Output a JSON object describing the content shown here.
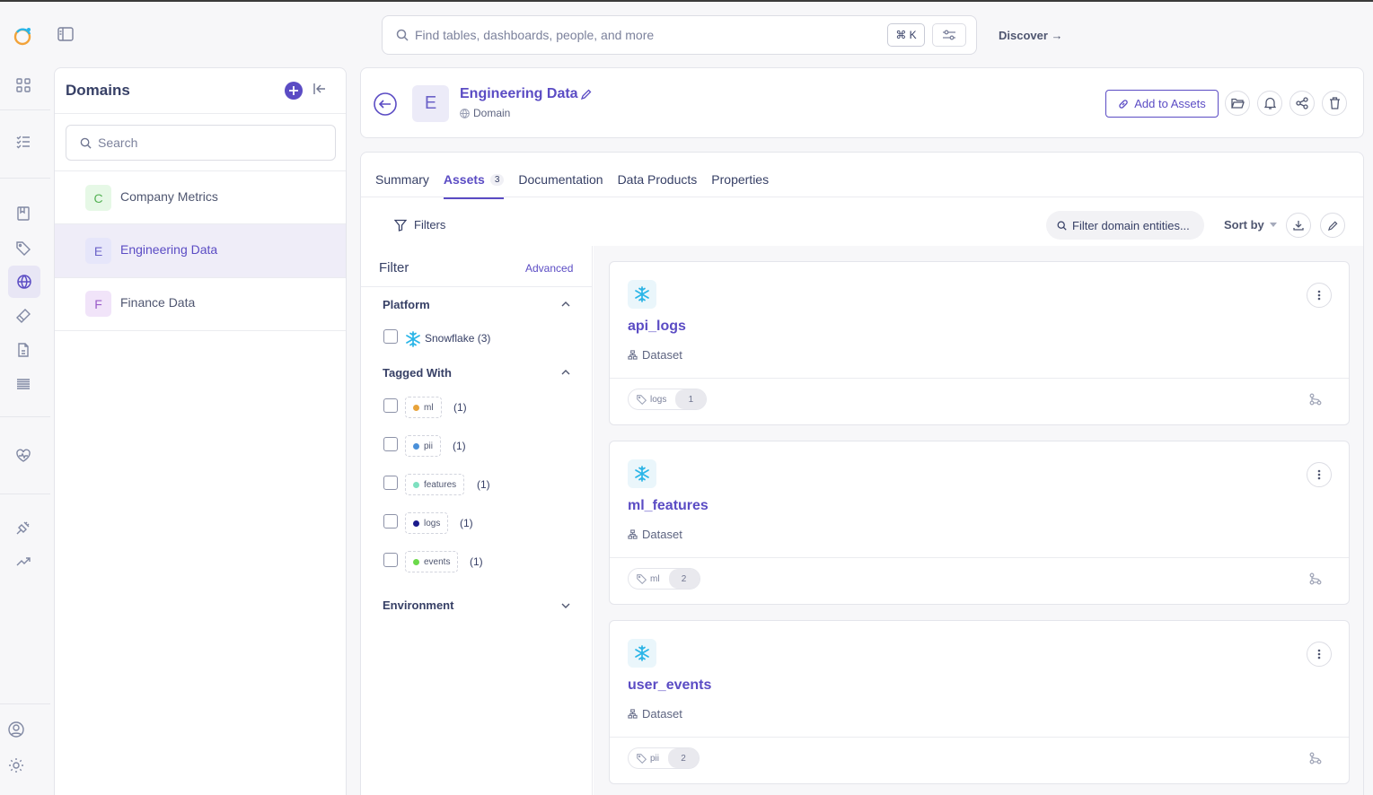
{
  "search": {
    "placeholder": "Find tables, dashboards, people, and more",
    "shortcut": "⌘ K"
  },
  "top": {
    "discover_label": "Discover →"
  },
  "domains": {
    "title": "Domains",
    "search_placeholder": "Search",
    "items": [
      {
        "letter": "C",
        "name": "Company Metrics",
        "color": "#dff7df",
        "text_color": "#55b255"
      },
      {
        "letter": "E",
        "name": "Engineering Data",
        "color": "#e6e6fa",
        "text_color": "#6c63c8"
      },
      {
        "letter": "F",
        "name": "Finance Data",
        "color": "#f1e4f9",
        "text_color": "#9b5cc8"
      }
    ]
  },
  "entity": {
    "letter": "E",
    "name": "Engineering Data",
    "type": "Domain",
    "add_to_assets": "Add to Assets"
  },
  "tabs": [
    {
      "label": "Summary"
    },
    {
      "label": "Assets",
      "count": "3"
    },
    {
      "label": "Documentation"
    },
    {
      "label": "Data Products"
    },
    {
      "label": "Properties"
    }
  ],
  "toolbar": {
    "filters_label": "Filters",
    "filter_search_placeholder": "Filter domain entities...",
    "sort_label": "Sort by"
  },
  "filter": {
    "title": "Filter",
    "advanced": "Advanced",
    "platform_title": "Platform",
    "platform_option": "Snowflake (3)",
    "tagged_title": "Tagged With",
    "tags": [
      {
        "name": "ml",
        "count": "(1)",
        "color": "#e8a33a"
      },
      {
        "name": "pii",
        "count": "(1)",
        "color": "#4a90d9"
      },
      {
        "name": "features",
        "count": "(1)",
        "color": "#7ee0c0"
      },
      {
        "name": "logs",
        "count": "(1)",
        "color": "#1a1a8c"
      },
      {
        "name": "events",
        "count": "(1)",
        "color": "#6bd94a"
      }
    ],
    "environment_title": "Environment"
  },
  "results": [
    {
      "name": "api_logs",
      "type": "Dataset",
      "tag": "logs",
      "tag_count": "1"
    },
    {
      "name": "ml_features",
      "type": "Dataset",
      "tag": "ml",
      "tag_count": "2"
    },
    {
      "name": "user_events",
      "type": "Dataset",
      "tag": "pii",
      "tag_count": "2"
    }
  ],
  "colors": {
    "accent": "#5b4cc4",
    "snowflake": "#29b5e8"
  }
}
